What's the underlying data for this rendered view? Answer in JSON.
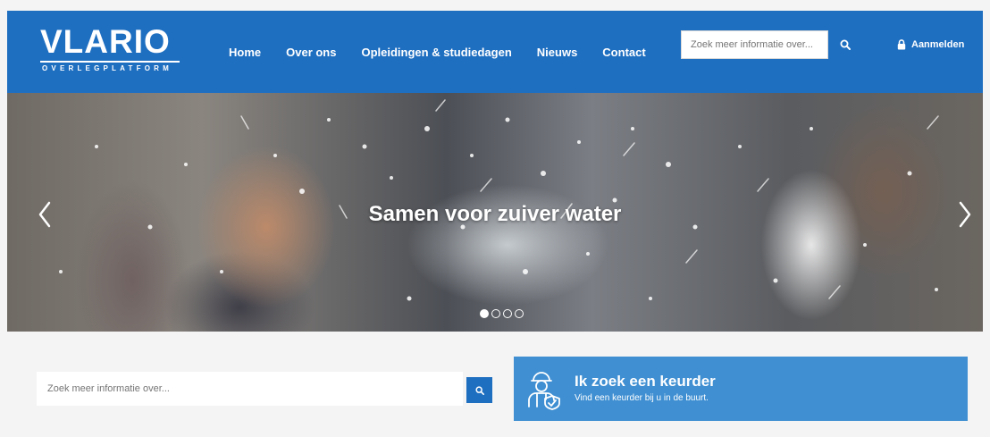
{
  "header": {
    "logo_main": "VLARIO",
    "logo_sub": "OVERLEGPLATFORM",
    "nav": [
      "Home",
      "Over ons",
      "Opleidingen & studiedagen",
      "Nieuws",
      "Contact"
    ],
    "search_placeholder": "Zoek meer informatie over...",
    "login_label": "Aanmelden",
    "search_icon": "search-icon",
    "login_icon": "lock-icon"
  },
  "hero": {
    "title": "Samen voor zuiver water",
    "slide_count": 4,
    "active_slide": 1,
    "prev_icon": "chevron-left-icon",
    "next_icon": "chevron-right-icon"
  },
  "bottom": {
    "search_placeholder": "Zoek meer informatie over...",
    "search_icon": "search-icon",
    "keurder_icon": "inspector-icon",
    "keurder_title": "Ik zoek een keurder",
    "keurder_sub": "Vind een keurder bij u in de buurt."
  },
  "colors": {
    "brand_blue": "#1f6fc1",
    "card_blue": "#3f8fd2",
    "background": "#f4f4f4"
  }
}
